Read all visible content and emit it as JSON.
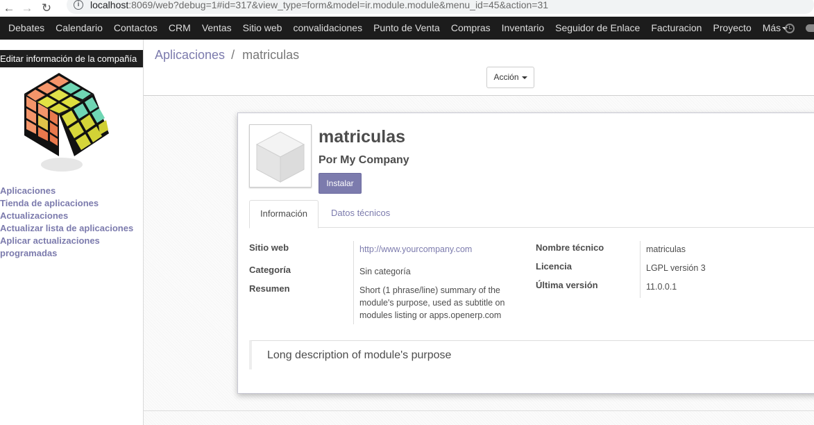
{
  "browser": {
    "url_host": "localhost",
    "url_rest": ":8069/web?debug=1#id=317&view_type=form&model=ir.module.module&menu_id=45&action=31"
  },
  "topmenu": {
    "items": [
      "Debates",
      "Calendario",
      "Contactos",
      "CRM",
      "Ventas",
      "Sitio web",
      "convalidaciones",
      "Punto de Venta",
      "Compras",
      "Inventario",
      "Seguidor de Enlace",
      "Facturacion",
      "Proyecto"
    ],
    "more_label": "Más"
  },
  "sidebar": {
    "company_tooltip": "Editar información de la compañía",
    "links": [
      "Aplicaciones",
      "Tienda de aplicaciones",
      "Actualizaciones",
      "Actualizar lista de aplicaciones",
      "Aplicar actualizaciones",
      "programadas"
    ]
  },
  "breadcrumb": {
    "parent": "Aplicaciones",
    "separator": "/",
    "current": "matriculas"
  },
  "action_button": "Acción",
  "module": {
    "name": "matriculas",
    "author": "Por My Company",
    "install_label": "Instalar"
  },
  "tabs": [
    "Información",
    "Datos técnicos"
  ],
  "fields": {
    "website_label": "Sitio web",
    "website_value": "http://www.yourcompany.com",
    "category_label": "Categoría",
    "category_value": "Sin categoría",
    "summary_label": "Resumen",
    "summary_value": "Short (1 phrase/line) summary of the module's purpose, used as subtitle on modules listing or apps.openerp.com",
    "technical_name_label": "Nombre técnico",
    "technical_name_value": "matriculas",
    "license_label": "Licencia",
    "license_value": "LGPL versión 3",
    "version_label": "Última versión",
    "version_value": "11.0.0.1"
  },
  "description": "Long description of module's purpose",
  "colors": {
    "brand": "#7c7bad",
    "topbar": "#1c1c1c"
  }
}
